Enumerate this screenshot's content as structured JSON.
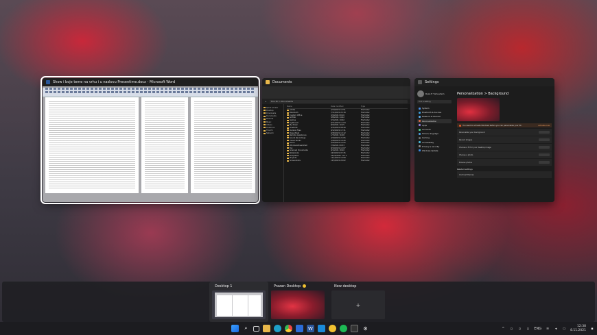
{
  "windows": {
    "word": {
      "title": "Show i boje teme na vrhu i u naslovu Presentime.docx - Microsoft Word"
    },
    "explorer": {
      "title": "Documents",
      "breadcrumb": "This PC > Documents",
      "columns": [
        "Name",
        "Date modified",
        "Type"
      ],
      "side_items": [
        "Quick access",
        "Desktop",
        "Downloads",
        "Documents",
        "Pictures",
        "Music",
        "Videos",
        "OneDrive",
        "This PC",
        "Network"
      ],
      "rows": [
        {
          "name": "Adobe",
          "date": "2/24/2021 12:51",
          "type": "File folder"
        },
        {
          "name": "Bluetooth",
          "date": "7/11/2021 22:18",
          "type": "File folder"
        },
        {
          "name": "Custom Office",
          "date": "3/2/2021 09:10",
          "type": "File folder"
        },
        {
          "name": "GitHub",
          "date": "5/8/2021 14:22",
          "type": "File folder"
        },
        {
          "name": "Games",
          "date": "5/1/2021 19:02",
          "type": "File folder"
        },
        {
          "name": "Lightroom",
          "date": "6/11/2021 11:04",
          "type": "File folder"
        },
        {
          "name": "My Music",
          "date": "8/2/2021 10:15",
          "type": "File folder"
        },
        {
          "name": "OneNote",
          "date": "4/15/2021 08:40",
          "type": "File folder"
        },
        {
          "name": "Outlook Files",
          "date": "9/12/2021 17:31",
          "type": "File folder"
        },
        {
          "name": "PowerShell",
          "date": "6/30/2021 13:12",
          "type": "File folder"
        },
        {
          "name": "Remote Assistance",
          "date": "1/7/2021 16:48",
          "type": "File folder"
        },
        {
          "name": "Sound Recordings",
          "date": "2/19/2021 21:05",
          "type": "File folder"
        },
        {
          "name": "Visual Studio",
          "date": "3/28/2021 10:26",
          "type": "File folder"
        },
        {
          "name": "Zoom",
          "date": "5/22/2021 14:55",
          "type": "File folder"
        },
        {
          "name": "WindowsPowerShell",
          "date": "7/4/2021 09:33",
          "type": "File folder"
        },
        {
          "name": "Fax",
          "date": "8/19/2021 12:07",
          "type": "File folder"
        },
        {
          "name": "Scanned Documents",
          "date": "9/1/2021 18:20",
          "type": "File folder"
        },
        {
          "name": "Notebooks",
          "date": "10/3/2021 07:45",
          "type": "File folder"
        },
        {
          "name": "Templates",
          "date": "10/20/2021 11:11",
          "type": "File folder"
        },
        {
          "name": "Projects",
          "date": "11/1/2021 15:58",
          "type": "File folder"
        },
        {
          "name": "Screenshots",
          "date": "11/5/2021 20:02",
          "type": "File folder"
        }
      ]
    },
    "settings": {
      "title": "Settings",
      "user": "Ryan E Tumushem",
      "search_placeholder": "Find a setting",
      "heading": "Personalization > Background",
      "warning": "You need to activate Windows before you can personalize your PC.",
      "warning_link": "Activate now",
      "nav": [
        "System",
        "Bluetooth & devices",
        "Network & internet",
        "Personalization",
        "Apps",
        "Accounts",
        "Time & language",
        "Gaming",
        "Accessibility",
        "Privacy & security",
        "Windows Update"
      ],
      "rows": [
        "Personalize your background",
        "Recent images",
        "Choose a fit for your desktop image",
        "Choose a photo",
        "Browse photos"
      ],
      "related_title": "Related settings",
      "related_row": "Contrast themes"
    }
  },
  "desktops": [
    {
      "label": "Desktop 1"
    },
    {
      "label": "Prazan Desktop"
    },
    {
      "label": "New desktop",
      "plus": "+"
    }
  ],
  "taskbar": {
    "language": "ENG",
    "time": "12:38",
    "date": "8.11.2021"
  },
  "colors": {
    "word": "#2b579a",
    "explorer": "#e8b74a",
    "settings": "#5a5a5a",
    "accent": "#0a84ff"
  }
}
